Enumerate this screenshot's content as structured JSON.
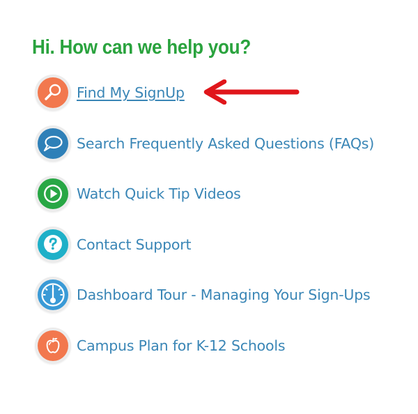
{
  "heading": "Hi. How can we help you?",
  "items": [
    {
      "label": "Find My SignUp",
      "icon": "magnifier-icon",
      "color": "#f2784e",
      "underlined": true
    },
    {
      "label": "Search Frequently Asked Questions (FAQs)",
      "icon": "chat-bubble-icon",
      "color": "#2f80b8"
    },
    {
      "label": "Watch Quick Tip Videos",
      "icon": "play-icon",
      "color": "#28a745"
    },
    {
      "label": "Contact Support",
      "icon": "question-mark-icon",
      "color": "#1fb0c8"
    },
    {
      "label": "Dashboard Tour - Managing Your Sign-Ups",
      "icon": "gauge-icon",
      "color": "#3a9ad6"
    },
    {
      "label": "Campus Plan for K-12 Schools",
      "icon": "apple-icon",
      "color": "#f2784e"
    }
  ],
  "colors": {
    "heading": "#2aa33e",
    "link": "#3a86b6",
    "arrow": "#e0161b"
  }
}
